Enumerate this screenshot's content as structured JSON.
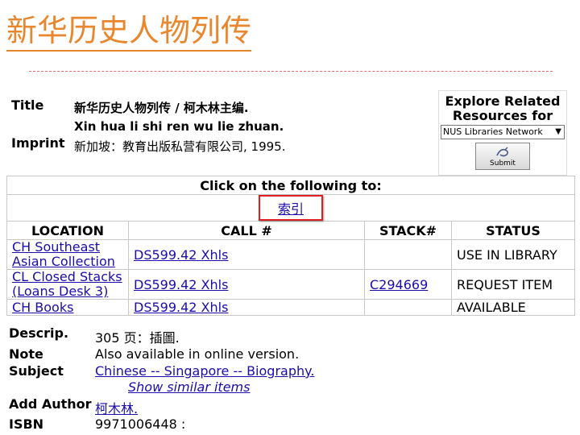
{
  "header": {
    "title": "新华历史人物列传"
  },
  "record": {
    "title_label": "Title",
    "title_chinese": "新华历史人物列传 / 柯木林主编.",
    "title_pinyin": "Xin hua li shi ren wu lie zhuan.",
    "imprint_label": "Imprint",
    "imprint_value": "新加坡：教育出版私营有限公司, 1995."
  },
  "explore": {
    "title": "Explore Related Resources for",
    "selected": "NUS Libraries Network",
    "submit_label": "Submit"
  },
  "click_following": "Click on the following to:",
  "index_link": "索引",
  "holdings": {
    "headers": [
      "LOCATION",
      "CALL #",
      "STACK#",
      "STATUS"
    ],
    "rows": [
      {
        "location": "CH Southeast Asian Collection",
        "location_l1": "CH Southeast",
        "location_l2": "Asian Collection",
        "call": "DS599.42 Xhls",
        "stack": "",
        "status": "USE IN LIBRARY"
      },
      {
        "location": "CL Closed Stacks (Loans Desk 3)",
        "location_l1": "CL Closed Stacks",
        "location_l2": "(Loans Desk 3)",
        "call": "DS599.42 Xhls",
        "stack": "C294669",
        "status": "REQUEST ITEM"
      },
      {
        "location": "CH Books",
        "location_l1": "CH Books",
        "location_l2": "",
        "call": "DS599.42 Xhls",
        "stack": "",
        "status": "AVAILABLE"
      }
    ]
  },
  "details": {
    "descrip_label": "Descrip.",
    "descrip_value": "305 页：插圖.",
    "note_label": "Note",
    "note_value": "Also available in online version.",
    "subject_label": "Subject",
    "subject_value": "Chinese -- Singapore -- Biography.",
    "similar_label": "Show similar items",
    "add_author_label": "Add Author",
    "add_author_value": "柯木林.",
    "isbn_label": "ISBN",
    "isbn_value": "9971006448 :"
  },
  "colors": {
    "title": "#e8872e",
    "link": "#1a0dab",
    "highlight": "#e02020"
  }
}
